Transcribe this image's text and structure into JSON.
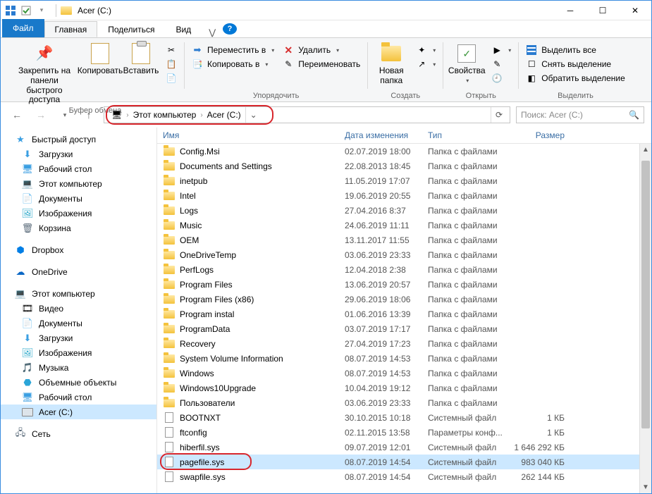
{
  "window": {
    "title": "Acer (C:)"
  },
  "tabs": {
    "file": "Файл",
    "home": "Главная",
    "share": "Поделиться",
    "view": "Вид"
  },
  "ribbon": {
    "pin": "Закрепить на панели\nбыстрого доступа",
    "copy": "Копировать",
    "paste": "Вставить",
    "clipboard_group": "Буфер обмена",
    "move_to": "Переместить в",
    "copy_to": "Копировать в",
    "delete": "Удалить",
    "rename": "Переименовать",
    "organize_group": "Упорядочить",
    "new_folder": "Новая\nпапка",
    "new_group": "Создать",
    "properties": "Свойства",
    "open_group": "Открыть",
    "select_all": "Выделить все",
    "deselect": "Снять выделение",
    "invert": "Обратить выделение",
    "select_group": "Выделить"
  },
  "address": {
    "this_pc": "Этот компьютер",
    "drive": "Acer (C:)",
    "search_placeholder": "Поиск: Acer (C:)"
  },
  "columns": {
    "name": "Имя",
    "date": "Дата изменения",
    "type": "Тип",
    "size": "Размер"
  },
  "sidebar": {
    "quick": "Быстрый доступ",
    "downloads": "Загрузки",
    "desktop": "Рабочий стол",
    "this_pc": "Этот компьютер",
    "documents": "Документы",
    "pictures": "Изображения",
    "recycle": "Корзина",
    "dropbox": "Dropbox",
    "onedrive": "OneDrive",
    "this_pc2": "Этот компьютер",
    "video": "Видео",
    "documents2": "Документы",
    "downloads2": "Загрузки",
    "pictures2": "Изображения",
    "music": "Музыка",
    "objects3d": "Объемные объекты",
    "desktop2": "Рабочий стол",
    "acer": "Acer (C:)",
    "network": "Сеть"
  },
  "files": [
    {
      "ico": "folder",
      "name": "Config.Msi",
      "date": "02.07.2019 18:00",
      "type": "Папка с файлами",
      "size": ""
    },
    {
      "ico": "folder",
      "name": "Documents and Settings",
      "date": "22.08.2013 18:45",
      "type": "Папка с файлами",
      "size": ""
    },
    {
      "ico": "folder",
      "name": "inetpub",
      "date": "11.05.2019 17:07",
      "type": "Папка с файлами",
      "size": ""
    },
    {
      "ico": "folder",
      "name": "Intel",
      "date": "19.06.2019 20:55",
      "type": "Папка с файлами",
      "size": ""
    },
    {
      "ico": "folder",
      "name": "Logs",
      "date": "27.04.2016 8:37",
      "type": "Папка с файлами",
      "size": ""
    },
    {
      "ico": "folder",
      "name": "Music",
      "date": "24.06.2019 11:11",
      "type": "Папка с файлами",
      "size": ""
    },
    {
      "ico": "folder",
      "name": "OEM",
      "date": "13.11.2017 11:55",
      "type": "Папка с файлами",
      "size": ""
    },
    {
      "ico": "folder",
      "name": "OneDriveTemp",
      "date": "03.06.2019 23:33",
      "type": "Папка с файлами",
      "size": ""
    },
    {
      "ico": "folder",
      "name": "PerfLogs",
      "date": "12.04.2018 2:38",
      "type": "Папка с файлами",
      "size": ""
    },
    {
      "ico": "folder",
      "name": "Program Files",
      "date": "13.06.2019 20:57",
      "type": "Папка с файлами",
      "size": ""
    },
    {
      "ico": "folder",
      "name": "Program Files (x86)",
      "date": "29.06.2019 18:06",
      "type": "Папка с файлами",
      "size": ""
    },
    {
      "ico": "folder",
      "name": "Program instal",
      "date": "01.06.2016 13:39",
      "type": "Папка с файлами",
      "size": ""
    },
    {
      "ico": "folder",
      "name": "ProgramData",
      "date": "03.07.2019 17:17",
      "type": "Папка с файлами",
      "size": ""
    },
    {
      "ico": "folder",
      "name": "Recovery",
      "date": "27.04.2019 17:23",
      "type": "Папка с файлами",
      "size": ""
    },
    {
      "ico": "folder",
      "name": "System Volume Information",
      "date": "08.07.2019 14:53",
      "type": "Папка с файлами",
      "size": ""
    },
    {
      "ico": "folder",
      "name": "Windows",
      "date": "08.07.2019 14:53",
      "type": "Папка с файлами",
      "size": ""
    },
    {
      "ico": "folder",
      "name": "Windows10Upgrade",
      "date": "10.04.2019 19:12",
      "type": "Папка с файлами",
      "size": ""
    },
    {
      "ico": "folder",
      "name": "Пользователи",
      "date": "03.06.2019 23:33",
      "type": "Папка с файлами",
      "size": ""
    },
    {
      "ico": "file",
      "name": "BOOTNXT",
      "date": "30.10.2015 10:18",
      "type": "Системный файл",
      "size": "1 КБ"
    },
    {
      "ico": "file",
      "name": "ftconfig",
      "date": "02.11.2015 13:58",
      "type": "Параметры конф...",
      "size": "1 КБ"
    },
    {
      "ico": "file",
      "name": "hiberfil.sys",
      "date": "09.07.2019 12:01",
      "type": "Системный файл",
      "size": "1 646 292 КБ"
    },
    {
      "ico": "file",
      "name": "pagefile.sys",
      "date": "08.07.2019 14:54",
      "type": "Системный файл",
      "size": "983 040 КБ",
      "selected": true,
      "highlight": true
    },
    {
      "ico": "file",
      "name": "swapfile.sys",
      "date": "08.07.2019 14:54",
      "type": "Системный файл",
      "size": "262 144 КБ"
    }
  ]
}
